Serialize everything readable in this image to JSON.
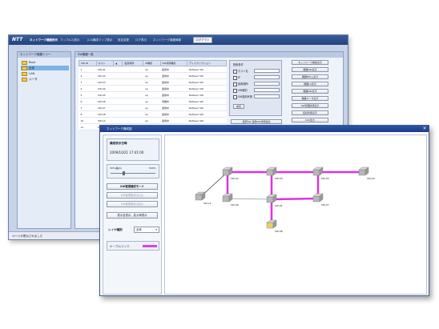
{
  "back_window": {
    "logo": "NTT",
    "tabs": [
      "ネットワーク機器表示",
      "マップ(L2)表示",
      "(L3)構成マップ表示",
      "設定変更",
      "ログ表示",
      "ネットワーク機器情報"
    ],
    "logout": "ログアウト",
    "tree_title": "ネットワーク機器ツリー",
    "tree_items": [
      {
        "label": "Root",
        "selected": false
      },
      {
        "label": "全体",
        "selected": true
      },
      {
        "label": "LAN",
        "selected": false
      },
      {
        "label": "ルータ",
        "selected": false
      }
    ],
    "list_title": "SW機器一覧",
    "table_headers": [
      "SW-ID",
      "ホスト",
      "▲",
      "設置場所",
      "IP種別",
      "SW状態種別",
      "ディスクリプション"
    ],
    "table_rows": [
      [
        "1",
        "SW-01",
        "",
        "",
        "up",
        "運用中",
        "NetGear SW"
      ],
      [
        "2",
        "SW-02",
        "",
        "",
        "up",
        "運用中",
        "NetGear SW"
      ],
      [
        "3",
        "SW-03",
        "",
        "",
        "up",
        "運用中",
        "NetGear SW"
      ],
      [
        "4",
        "SW-04",
        "",
        "",
        "up",
        "運用中",
        "NetGear SW"
      ],
      [
        "5",
        "SW-05",
        "",
        "",
        "up",
        "運用中",
        "NetGear SW"
      ],
      [
        "6",
        "SW-06",
        "",
        "",
        "up",
        "待機中",
        "NetGear SW"
      ],
      [
        "7",
        "SW-07",
        "",
        "",
        "up",
        "運用中",
        "NetGear SW"
      ],
      [
        "8",
        "SW-08",
        "",
        "",
        "up",
        "運用中",
        "NetGear SW"
      ],
      [
        "10",
        "SW-10",
        "",
        "",
        "up",
        "運用中",
        "NetGear SW"
      ],
      [
        "11",
        "SW-11",
        "",
        "",
        "up",
        "運用中",
        "NetGear SW"
      ]
    ],
    "filter": {
      "title": "検索条件",
      "fields": [
        "ホスト名",
        "IP",
        "設置場所",
        "SW種別",
        "SW運用状態"
      ],
      "search_button": "検索"
    },
    "filter_buttons": [
      "選択SW 運用SW状態追加",
      "全SW 運用SW状態追加"
    ],
    "right_buttons": [
      "ネットワーク構成表示",
      "機器NW表示",
      "機器NW入出力",
      "機器L2表示",
      "機器NW表示",
      "機器ユーザ表示",
      "SW管理情報表示",
      "接続状態表示",
      "CSV出力"
    ],
    "status": "ページが表示されました"
  },
  "front_window": {
    "title": "ネットワーク構成図",
    "close": "×",
    "update_label": "構成表示日時",
    "update_value": "2009/10/21 17:41:00",
    "zoom_min": "30%(縮小)",
    "zoom_max": "500%",
    "zoom_level_fraction": 0.3,
    "buttons": {
      "primary": "SW管理構成モード",
      "disabled1": "SW管理構成(戻る)",
      "disabled2": "SW管理構成(保存)",
      "fit": "表示名表示、拡大率表示"
    },
    "layer_label": "レイヤ種別",
    "layer_value": "全体",
    "legend_label": "ケーブル/リンク",
    "colors": {
      "link": "#dd33dd",
      "legend": "#e040e0"
    }
  },
  "network_map": {
    "nodes": [
      {
        "id": "sw02",
        "label": "SW-02"
      },
      {
        "id": "sw03",
        "label": "SW-03"
      },
      {
        "id": "sw05",
        "label": "SW-05"
      },
      {
        "id": "sw04",
        "label": "SW-04"
      },
      {
        "id": "sw06",
        "label": "SW-06"
      },
      {
        "id": "sw01",
        "label": "SW-01"
      },
      {
        "id": "sw07",
        "label": "SW-07"
      },
      {
        "id": "sw08",
        "label": "SW-08"
      },
      {
        "id": "host",
        "label": "SW-L3"
      }
    ],
    "links": [
      [
        "sw02",
        "sw03"
      ],
      [
        "sw03",
        "sw05"
      ],
      [
        "sw05",
        "sw04"
      ],
      [
        "sw02",
        "sw06"
      ],
      [
        "sw06",
        "sw01"
      ],
      [
        "sw01",
        "sw07"
      ],
      [
        "sw03",
        "sw08"
      ],
      [
        "sw05",
        "sw07"
      ],
      [
        "sw02",
        "host"
      ]
    ]
  }
}
